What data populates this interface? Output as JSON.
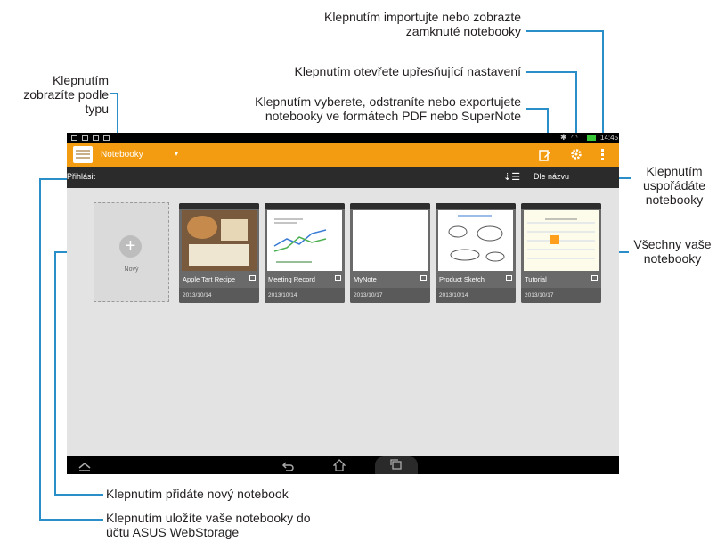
{
  "callouts": {
    "import_locked": "Klepnutím importujte nebo zobrazte zamknuté notebooky",
    "advanced_settings": "Klepnutím otevřete upřesňující nastavení",
    "select_delete_export": "Klepnutím vyberete, odstraníte nebo exportujete notebooky ve formátech PDF nebo SuperNote",
    "view_by_type": "Klepnutím zobrazíte podle typu",
    "sort_notebooks": "Klepnutím uspořádáte notebooky",
    "all_notebooks": "Všechny vaše notebooky",
    "add_notebook": "Klepnutím přidáte nový notebook",
    "save_webstorage": "Klepnutím uložíte vaše notebooky do účtu ASUS WebStorage"
  },
  "status_bar": {
    "time": "14:45"
  },
  "action_bar": {
    "title": "Notebooky",
    "dropdown_arrow": "▾"
  },
  "toolbar": {
    "login_label": "Přihlásit",
    "sort_label": "Dle názvu"
  },
  "new_notebook": {
    "label": "Nový",
    "plus": "+"
  },
  "notebooks": [
    {
      "title": "Apple Tart Recipe",
      "date": "2013/10/14"
    },
    {
      "title": "Meeting Record",
      "date": "2013/10/14"
    },
    {
      "title": "MyNote",
      "date": "2013/10/17"
    },
    {
      "title": "Product Sketch",
      "date": "2013/10/14"
    },
    {
      "title": "Tutorial",
      "date": "2013/10/17"
    }
  ],
  "icons": {
    "edit": "edit-icon",
    "settings": "gear-icon",
    "menu": "overflow-menu-icon",
    "sort": "sort-icon",
    "back": "back-icon",
    "home": "home-icon",
    "recent": "recent-apps-icon"
  },
  "colors": {
    "action_bar": "#f39c12",
    "callout_line": "#2a8fc9"
  }
}
